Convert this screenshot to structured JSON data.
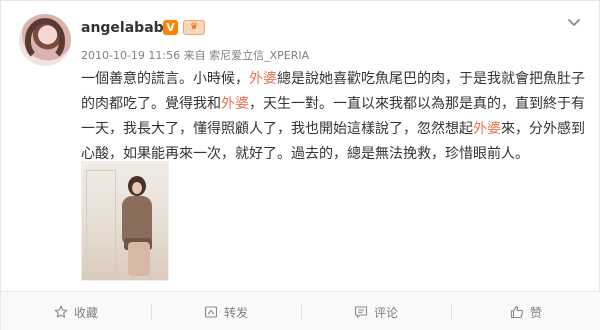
{
  "user": {
    "name": "angelababy",
    "verified_badge": "V",
    "member_badge_icon": "crown-icon"
  },
  "meta": {
    "timestamp": "2010-10-19 11:56",
    "source_prefix": "来自",
    "source": "索尼爱立信_XPERIA"
  },
  "post": {
    "segments": [
      {
        "text": "一個善意的謊言。小時候，",
        "highlight": false
      },
      {
        "text": "外婆",
        "highlight": true
      },
      {
        "text": "總是說她喜歡吃魚尾巴的肉，于是我就會把魚肚子的肉都吃了。覺得我和",
        "highlight": false
      },
      {
        "text": "外婆",
        "highlight": true
      },
      {
        "text": "，天生一對。一直以來我都以為那是真的，直到終于有一天，我長大了，懂得照顧人了，我也開始這樣說了，忽然想起",
        "highlight": false
      },
      {
        "text": "外婆",
        "highlight": true
      },
      {
        "text": "來，分外感到心酸，如果能再來一次，就好了。過去的，總是無法挽救，珍惜眼前人。",
        "highlight": false
      }
    ]
  },
  "actions": {
    "favorite": {
      "label": "收藏",
      "icon": "star-icon"
    },
    "repost": {
      "label": "转发",
      "icon": "repost-icon"
    },
    "comment": {
      "label": "评论",
      "icon": "comment-icon"
    },
    "like": {
      "label": "赞",
      "icon": "thumbs-up-icon"
    }
  },
  "colors": {
    "highlight": "#eb7350",
    "verified": "#ff8200",
    "muted_text": "#808080"
  }
}
